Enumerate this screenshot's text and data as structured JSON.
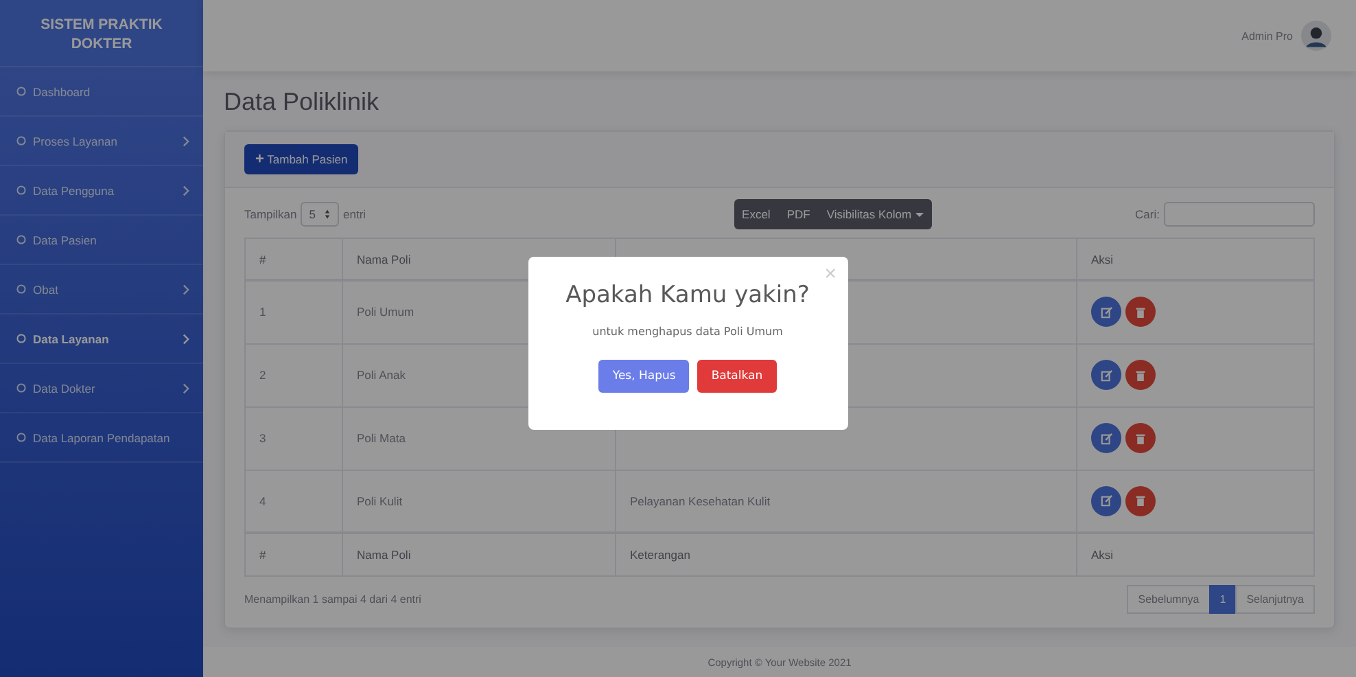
{
  "sidebar": {
    "brand": "SISTEM PRAKTIK DOKTER",
    "items": [
      {
        "label": "Dashboard",
        "has_submenu": false,
        "selected": false
      },
      {
        "label": "Proses Layanan",
        "has_submenu": true,
        "selected": false
      },
      {
        "label": "Data Pengguna",
        "has_submenu": true,
        "selected": false
      },
      {
        "label": "Data Pasien",
        "has_submenu": false,
        "selected": false
      },
      {
        "label": "Obat",
        "has_submenu": true,
        "selected": false
      },
      {
        "label": "Data Layanan",
        "has_submenu": true,
        "selected": true
      },
      {
        "label": "Data Dokter",
        "has_submenu": true,
        "selected": false
      },
      {
        "label": "Data Laporan Pendapatan",
        "has_submenu": false,
        "selected": false
      }
    ]
  },
  "topbar": {
    "user_name": "Admin Pro"
  },
  "page_title": "Data Poliklinik",
  "add_button": {
    "icon": "+",
    "label": "Tambah Pasien"
  },
  "table_controls": {
    "show_label": "Tampilkan",
    "page_size": "5",
    "entries_label": "entri",
    "export_buttons": [
      "Excel",
      "PDF",
      "Visibilitas Kolom"
    ],
    "search_label": "Cari:"
  },
  "table": {
    "columns": [
      "#",
      "Nama Poli",
      "Aksi"
    ],
    "rows": [
      {
        "no": "1",
        "name": "Poli Umum"
      },
      {
        "no": "2",
        "name": "Poli Anak"
      },
      {
        "no": "3",
        "name": "Poli Mata"
      },
      {
        "no": "4",
        "name": "Poli Kulit",
        "description": "Pelayanan Kesehatan Kulit"
      }
    ],
    "footer_columns": [
      "#",
      "Nama Poli",
      "Keterangan",
      "Aksi"
    ]
  },
  "table_info": "Menampilkan 1 sampai 4 dari 4 entri",
  "pagination": [
    {
      "label": "Sebelumnya",
      "selected": false
    },
    {
      "label": "1",
      "selected": true
    },
    {
      "label": "Selanjutnya",
      "selected": false
    }
  ],
  "footer": "Copyright © Your Website 2021",
  "dialog": {
    "title": "Apakah Kamu yakin?",
    "close": "×",
    "message": "untuk menghapus data Poli Umum",
    "confirm": "Yes, Hapus",
    "cancel": "Batalkan"
  }
}
